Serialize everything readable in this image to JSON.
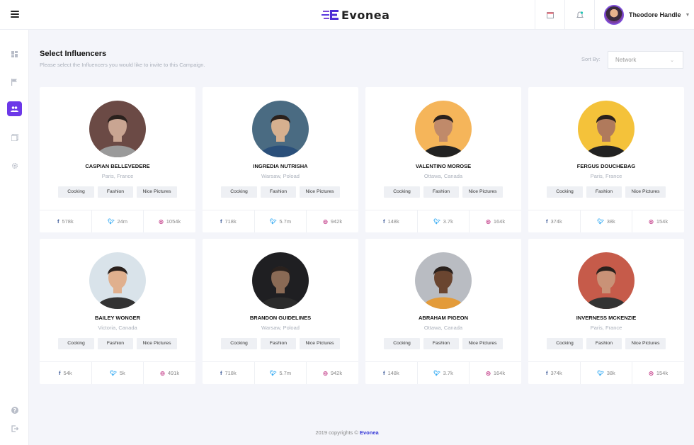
{
  "header": {
    "brand": "Evonea",
    "user_name": "Theodore Handle"
  },
  "page": {
    "title": "Select Influencers",
    "subtitle": "Please select the Influencers you would like to invite to this Campaign.",
    "sort_label": "Sort By:",
    "sort_value": "Network"
  },
  "influencers": [
    {
      "name": "CASPIAN BELLEVEDERE",
      "location": "Paris, France",
      "tags": [
        "Cocking",
        "Fashion",
        "Nice Pictures"
      ],
      "facebook": "578k",
      "twitter": "24m",
      "instagram": "1054k"
    },
    {
      "name": "INGREDIA NUTRISHA",
      "location": "Warsaw, Poload",
      "tags": [
        "Cocking",
        "Fashion",
        "Nice Pictures"
      ],
      "facebook": "718k",
      "twitter": "5.7m",
      "instagram": "942k"
    },
    {
      "name": "VALENTINO MOROSE",
      "location": "Ottawa, Canada",
      "tags": [
        "Cocking",
        "Fashion",
        "Nice Pictures"
      ],
      "facebook": "148k",
      "twitter": "3.7k",
      "instagram": "164k"
    },
    {
      "name": "FERGUS DOUCHEBAG",
      "location": "Paris, France",
      "tags": [
        "Cocking",
        "Fashion",
        "Nice Pictures"
      ],
      "facebook": "374k",
      "twitter": "38k",
      "instagram": "154k"
    },
    {
      "name": "BAILEY WONGER",
      "location": "Victoria, Canada",
      "tags": [
        "Cocking",
        "Fashion",
        "Nice Pictures"
      ],
      "facebook": "54k",
      "twitter": "5k",
      "instagram": "491k"
    },
    {
      "name": "BRANDON GUIDELINES",
      "location": "Warsaw, Poload",
      "tags": [
        "Cocking",
        "Fashion",
        "Nice Pictures"
      ],
      "facebook": "718k",
      "twitter": "5.7m",
      "instagram": "942k"
    },
    {
      "name": "ABRAHAM PIGEON",
      "location": "Ottawa, Canada",
      "tags": [
        "Cocking",
        "Fashion",
        "Nice Pictures"
      ],
      "facebook": "148k",
      "twitter": "3.7k",
      "instagram": "164k"
    },
    {
      "name": "INVERNESS MCKENZIE",
      "location": "Paris, France",
      "tags": [
        "Cocking",
        "Fashion",
        "Nice Pictures"
      ],
      "facebook": "374k",
      "twitter": "38k",
      "instagram": "154k"
    }
  ],
  "footer": {
    "text": "2019 copyrights ©",
    "brand": "Evonea"
  },
  "colors": {
    "accent": "#6c38e8",
    "background": "#f4f5fa",
    "facebook": "#3b5998",
    "twitter": "#1da1f2",
    "instagram": "#c13584"
  }
}
